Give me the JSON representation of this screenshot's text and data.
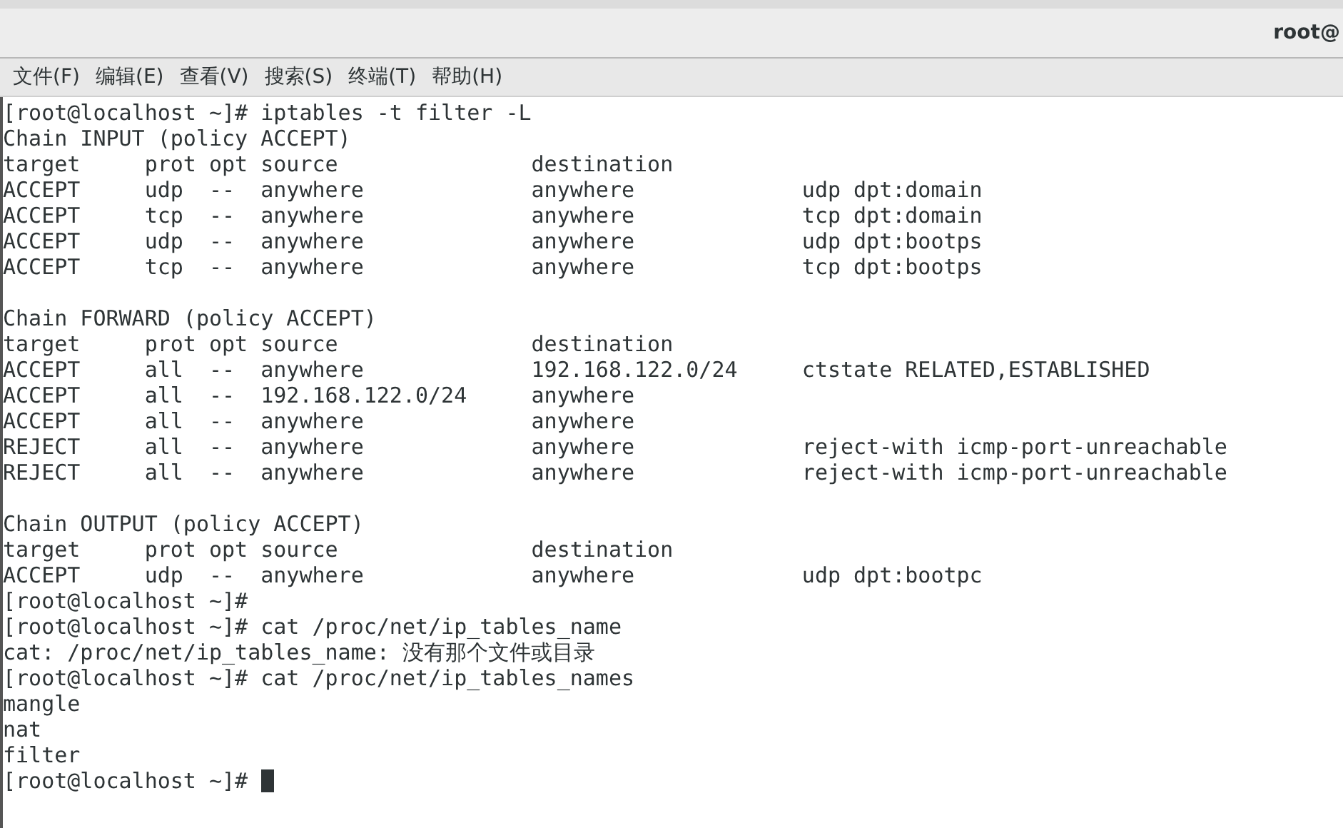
{
  "window": {
    "title": "root@"
  },
  "menu": [
    {
      "label": "文件(F)"
    },
    {
      "label": "编辑(E)"
    },
    {
      "label": "查看(V)"
    },
    {
      "label": "搜索(S)"
    },
    {
      "label": "终端(T)"
    },
    {
      "label": "帮助(H)"
    }
  ],
  "terminal": {
    "lines": [
      {
        "kind": "text",
        "text": "[root@localhost ~]# iptables -t filter -L"
      },
      {
        "kind": "text",
        "text": "Chain INPUT (policy ACCEPT)"
      },
      {
        "kind": "text",
        "text": "target     prot opt source               destination"
      },
      {
        "kind": "text",
        "text": "ACCEPT     udp  --  anywhere             anywhere             udp dpt:domain"
      },
      {
        "kind": "text",
        "text": "ACCEPT     tcp  --  anywhere             anywhere             tcp dpt:domain"
      },
      {
        "kind": "text",
        "text": "ACCEPT     udp  --  anywhere             anywhere             udp dpt:bootps"
      },
      {
        "kind": "text",
        "text": "ACCEPT     tcp  --  anywhere             anywhere             tcp dpt:bootps"
      },
      {
        "kind": "blank"
      },
      {
        "kind": "text",
        "text": "Chain FORWARD (policy ACCEPT)"
      },
      {
        "kind": "text",
        "text": "target     prot opt source               destination"
      },
      {
        "kind": "text",
        "text": "ACCEPT     all  --  anywhere             192.168.122.0/24     ctstate RELATED,ESTABLISHED"
      },
      {
        "kind": "text",
        "text": "ACCEPT     all  --  192.168.122.0/24     anywhere"
      },
      {
        "kind": "text",
        "text": "ACCEPT     all  --  anywhere             anywhere"
      },
      {
        "kind": "text",
        "text": "REJECT     all  --  anywhere             anywhere             reject-with icmp-port-unreachable"
      },
      {
        "kind": "text",
        "text": "REJECT     all  --  anywhere             anywhere             reject-with icmp-port-unreachable"
      },
      {
        "kind": "blank"
      },
      {
        "kind": "text",
        "text": "Chain OUTPUT (policy ACCEPT)"
      },
      {
        "kind": "text",
        "text": "target     prot opt source               destination"
      },
      {
        "kind": "text",
        "text": "ACCEPT     udp  --  anywhere             anywhere             udp dpt:bootpc"
      },
      {
        "kind": "text",
        "text": "[root@localhost ~]#"
      },
      {
        "kind": "text",
        "text": "[root@localhost ~]# cat /proc/net/ip_tables_name"
      },
      {
        "kind": "text",
        "text": "cat: /proc/net/ip_tables_name: 没有那个文件或目录"
      },
      {
        "kind": "text",
        "text": "[root@localhost ~]# cat /proc/net/ip_tables_names"
      },
      {
        "kind": "text",
        "text": "mangle"
      },
      {
        "kind": "text",
        "text": "nat"
      },
      {
        "kind": "text",
        "text": "filter"
      },
      {
        "kind": "prompt",
        "text": "[root@localhost ~]# "
      }
    ]
  }
}
